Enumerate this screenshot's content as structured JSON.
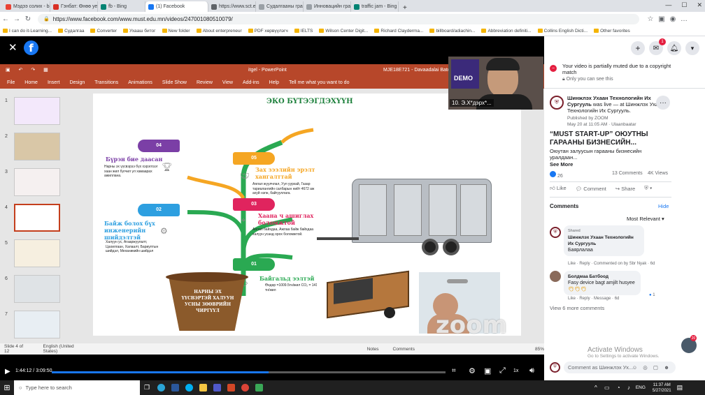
{
  "browser": {
    "tabs": [
      {
        "label": "Мэдээ солих - badraikhQ",
        "color": "#ea4335"
      },
      {
        "label": "Гэнбат: Өнөө уед тохир",
        "color": "#d93025"
      },
      {
        "label": "fb - Bing",
        "color": "#008373"
      },
      {
        "label": "(1) Facebook",
        "color": "#1877f2",
        "active": true
      },
      {
        "label": "https://www.sct.edu.mn/",
        "color": "#5f6368"
      },
      {
        "label": "Судалгааны грант олгох",
        "color": "#9aa0a6"
      },
      {
        "label": "Инновацийн грант – sct",
        "color": "#9aa0a6"
      },
      {
        "label": "traffic jam - Bing",
        "color": "#008373"
      }
    ],
    "url": "https://www.facebook.com/www.must.edu.mn/videos/247001080510079/",
    "bookmarks": [
      "I can do it-Learning...",
      "Судалгаа",
      "Converter",
      "Ухааш битог",
      "New folder",
      "About enterpreneur",
      "PDF хөрвүүлэгч",
      "IELTS",
      "Wilson Center Digit...",
      "Richard Clayderma...",
      "billboard/adiachin...",
      "Abbreviation definiti...",
      "Collins English Dicti...",
      "Other favorites"
    ]
  },
  "ppt": {
    "file": "itgel - PowerPoint",
    "doc_id": "MJE18E721 - Davaadalai Batdo...",
    "ribbon": [
      "File",
      "Home",
      "Insert",
      "Design",
      "Transitions",
      "Animations",
      "Slide Show",
      "Review",
      "View",
      "Add-ins",
      "Help",
      "Tell me what you want to do"
    ],
    "slide_numbers": [
      "1",
      "2",
      "3",
      "4",
      "5",
      "6",
      "7"
    ],
    "status_left": "Slide 4 of 12",
    "status_lang": "English (United States)",
    "notes": "Notes",
    "comments": "Comments",
    "zoom_level": "85%"
  },
  "slide": {
    "title": "ЭКО БҮТЭЭГДЭХҮҮН",
    "items": [
      {
        "num": "04",
        "heading": "Бүрэн бие даасан",
        "text": "Нарны эх үүсвэрээ бүх хэрэглээг хаан жил бүгчил үл хамаарах ажиллана.",
        "color": "#7b3fa6"
      },
      {
        "num": "02",
        "heading": "Байж болох бүх инженерийн шийдэлтэй",
        "text": "Халуун ус, Агааржуулалт, Цахилгаан, Халаалт, Бариултын шийдэл, Механикийн шийдэл",
        "color": "#2d9fe0"
      },
      {
        "num": "05",
        "heading": "Зах зээлийн эрэлт хангалттай",
        "text": "Аялал жуулчлал, Уул уурхай, Газар тариалангийн салбарын нийт 4672 аж ахуй нэгж, байгууллага.",
        "color": "#f5a623"
      },
      {
        "num": "03",
        "heading": "Хаана ч ашиглах боломжтой",
        "text": "Аялал байхдаа, Ажлаа байж байхдаа халуун усанд орох боломжтой.",
        "color": "#e0245e"
      },
      {
        "num": "01",
        "heading": "Байгальд ээлтэй",
        "text": "Өндөр =1009.5тн/жил CO₂ = 1419 тн/жил",
        "color": "#2aa952"
      }
    ],
    "pot_text": "НАРНЫ ЭХ ҮҮСВЭРТЭЙ ХАЛУУН УСНЫ ЗӨӨВРИЙН ЧИРГҮҮЛ",
    "watermark": "zoom"
  },
  "participant": {
    "label": "10. Э.Х*дэрх*...",
    "demo": "DEMO"
  },
  "player": {
    "time": "1:44:12 / 3:09:50",
    "progress": 0.55,
    "speed": "1x"
  },
  "sidebar": {
    "muted_notice": "Your video is partially muted due to a copyright match",
    "only_you": "Only you can see this",
    "page_name": "Шинжлэх Ухаан Технологийн Их Сургууль",
    "was_live": "was live — at Шинжлэх Ухаан Технологийн Их Сургууль.",
    "published_by": "Published by ZOOM",
    "post_date": "May 20 at 11:05 AM · Ulaanbaatar",
    "post_title": "“MUST START-UP” ОЮУТНЫ ГАРААНЫ БИЗНЕСИЙН...",
    "post_desc": "Оюутан залуусын гарааны бизнесийн уралдаан...",
    "see_more": "See More",
    "reactions": "26",
    "comments_count": "13 Comments",
    "views": "4K Views",
    "like": "Like",
    "comment": "Comment",
    "share": "Share",
    "comments_header": "Comments",
    "hide": "Hide",
    "most_relevant": "Most Relevant",
    "comment1": {
      "author": "Шинжлэх Ухаан Технологийн Их Сургууль",
      "tag": "Shared",
      "text": "Баярлалаа",
      "meta": "Like · Reply · Commented on by Sbr Nyak",
      "time": "6d"
    },
    "comment2": {
      "author": "Болдмаа Батбоод",
      "text": "Fasy device bagt amjilt husyee",
      "meta": "Like · Reply · Message",
      "time": "6d",
      "likes": "1"
    },
    "view_more": "View 6 more comments",
    "comment_placeholder": "Comment as Шинжлэх Ух...",
    "activate": "Activate Windows",
    "activate_sub": "Go to Settings to activate Windows.",
    "notif": "1"
  },
  "taskbar": {
    "search": "Type here to search",
    "lang": "ENG",
    "time": "11:37 AM",
    "date": "5/27/2021"
  }
}
